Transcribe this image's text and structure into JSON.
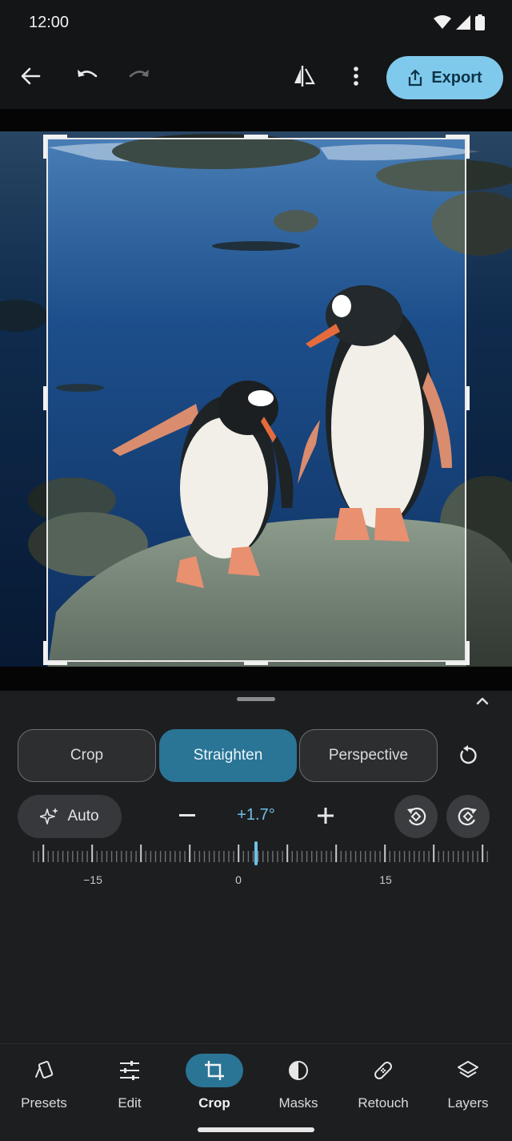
{
  "status_bar": {
    "time": "12:00",
    "icons": [
      "wifi-icon",
      "signal-icon",
      "battery-icon"
    ]
  },
  "app_bar": {
    "icons": [
      "back-arrow-icon",
      "undo-icon",
      "redo-icon",
      "compare-icon",
      "more-vert-icon"
    ],
    "export_label": "Export"
  },
  "canvas": {
    "image": "two gentoo penguins standing on a rock by blue water",
    "crop_frame": true
  },
  "crop_panel": {
    "modes": [
      {
        "label": "Crop",
        "active": false
      },
      {
        "label": "Straighten",
        "active": true
      },
      {
        "label": "Perspective",
        "active": false
      }
    ],
    "auto_label": "Auto",
    "angle_value": "+1.7°",
    "ruler_labels": [
      "−15",
      "0",
      "15"
    ],
    "accent_color": "#2a7496",
    "value_color": "#6fc0ea"
  },
  "bottom_nav": {
    "items": [
      {
        "label": "Presets",
        "icon": "presets-icon",
        "active": false
      },
      {
        "label": "Edit",
        "icon": "sliders-icon",
        "active": false
      },
      {
        "label": "Crop",
        "icon": "crop-icon",
        "active": true
      },
      {
        "label": "Masks",
        "icon": "masks-icon",
        "active": false
      },
      {
        "label": "Retouch",
        "icon": "bandage-icon",
        "active": false
      },
      {
        "label": "Layers",
        "icon": "layers-icon",
        "active": false
      }
    ]
  }
}
